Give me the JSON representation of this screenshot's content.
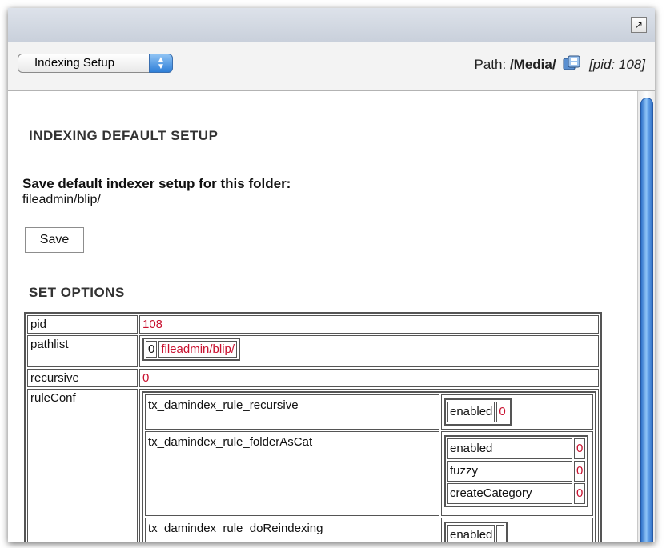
{
  "toolbar": {
    "select_value": "Indexing Setup",
    "path_label": "Path:",
    "path_value": "/Media/",
    "pid_text": "[pid: 108]"
  },
  "main": {
    "heading_default": "INDEXING DEFAULT SETUP",
    "save_heading": "Save default indexer setup for this folder:",
    "folder_path": "fileadmin/blip/",
    "save_label": "Save",
    "heading_options": "SET OPTIONS"
  },
  "options": {
    "pid": {
      "key": "pid",
      "value": "108"
    },
    "pathlist": {
      "key": "pathlist",
      "index": "0",
      "value": "fileadmin/blip/"
    },
    "recursive": {
      "key": "recursive",
      "value": "0"
    },
    "ruleConf": {
      "key": "ruleConf",
      "rules": [
        {
          "name": "tx_damindex_rule_recursive",
          "fields": [
            {
              "key": "enabled",
              "value": "0"
            }
          ]
        },
        {
          "name": "tx_damindex_rule_folderAsCat",
          "fields": [
            {
              "key": "enabled",
              "value": "0"
            },
            {
              "key": "fuzzy",
              "value": "0"
            },
            {
              "key": "createCategory",
              "value": "0"
            }
          ]
        },
        {
          "name": "tx_damindex_rule_doReindexing",
          "fields": [
            {
              "key": "enabled",
              "value": ""
            }
          ]
        }
      ]
    }
  },
  "colors": {
    "value_red": "#c8102e",
    "scroll_blue": "#3b82e0"
  },
  "icons": {
    "popout": "external-window-icon",
    "page": "folder-page-icon"
  }
}
